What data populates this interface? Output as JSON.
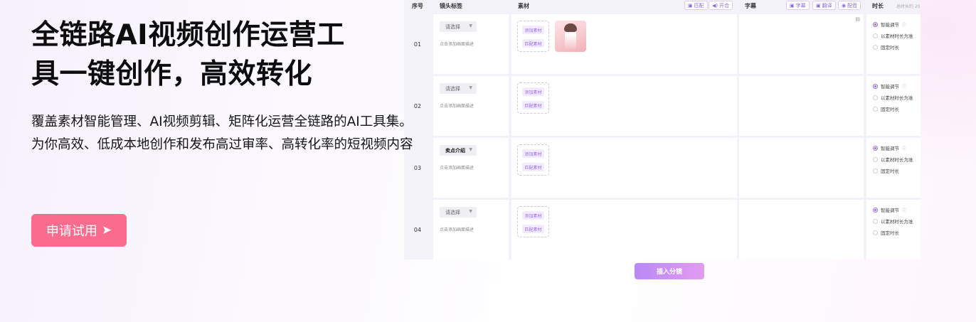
{
  "hero": {
    "title_line1": "全链路AI视频创作运营工",
    "title_line2": "具一键创作，高效转化",
    "desc_line1": "覆盖素材智能管理、AI视频剪辑、矩阵化运营全链路的AI工具集。",
    "desc_line2": "为你高效、低成本地创作和发布高过审率、高转化率的短视频内容",
    "cta_label": "申请试用",
    "cta_arrow": "➤"
  },
  "editor": {
    "headers": {
      "index": "序号",
      "tag": "镜头标签",
      "material": "素材",
      "subtitle": "字幕",
      "duration": "时长"
    },
    "material_tools": [
      {
        "icon": "▣",
        "label": "匹配"
      },
      {
        "icon": "◀)",
        "label": "开合"
      }
    ],
    "subtitle_tools": [
      {
        "icon": "▣",
        "label": "字幕"
      },
      {
        "icon": "▣",
        "label": "翻译"
      },
      {
        "icon": "◉",
        "label": "配音"
      }
    ],
    "duration_note": "总时长约 20",
    "add_material_label": "添加素材",
    "match_material_label": "匹配素材",
    "desc_hint": "点击添加画面描述",
    "select_caret": "▼",
    "subtitle_icon": "▤",
    "info_icon": "ⓘ",
    "duration_options": [
      "智能调节",
      "以素材时长为准",
      "固定时长"
    ],
    "rows": [
      {
        "index": "01",
        "tag": "请选择",
        "has_thumb": true
      },
      {
        "index": "02",
        "tag": "请选择",
        "has_thumb": false
      },
      {
        "index": "03",
        "tag": "卖点介绍",
        "has_thumb": false
      },
      {
        "index": "04",
        "tag": "请选择",
        "has_thumb": false
      }
    ],
    "insert_label": "插入分镜"
  },
  "colors": {
    "cta": "#fb6b8d",
    "accent_purple": "#9c6ce0",
    "insert_gradient_start": "#b889f5",
    "insert_gradient_end": "#e29cf0"
  }
}
